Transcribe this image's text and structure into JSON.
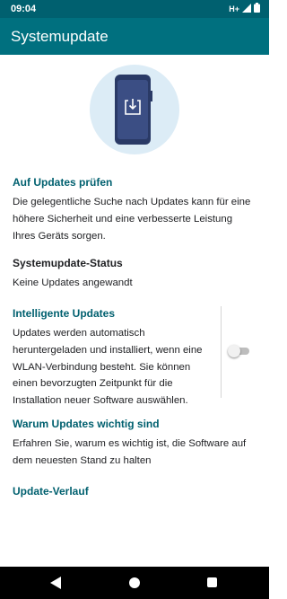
{
  "status_bar": {
    "time": "09:04",
    "network_label": "H+",
    "icons": [
      "signal-icon",
      "battery-icon"
    ]
  },
  "app_bar": {
    "title": "Systemupdate",
    "color": "#00707f"
  },
  "illustration": {
    "icon": "download-to-phone-icon"
  },
  "sections": {
    "check_updates": {
      "title": "Auf Updates prüfen",
      "description": "Die gelegentliche Suche nach Updates kann für eine höhere Sicherheit und eine verbesserte Leistung Ihres Geräts sorgen."
    },
    "status": {
      "title": "Systemupdate-Status",
      "value": "Keine Updates angewandt"
    },
    "smart_updates": {
      "title": "Intelligente Updates",
      "description": "Updates werden automatisch heruntergeladen und installiert, wenn eine WLAN-Verbindung besteht. Sie können einen bevorzugten Zeitpunkt für die Installation neuer Software auswählen.",
      "toggle_on": false
    },
    "why_updates": {
      "title": "Warum Updates wichtig sind",
      "description": "Erfahren Sie, warum es wichtig ist, die Software auf dem neuesten Stand zu halten"
    },
    "history": {
      "title": "Update-Verlauf"
    }
  },
  "nav_bar": {
    "icons": [
      "back-icon",
      "home-icon",
      "recents-icon"
    ]
  },
  "colors": {
    "accent": "#00707f",
    "status_bar": "#00606f",
    "link": "#00606f"
  }
}
